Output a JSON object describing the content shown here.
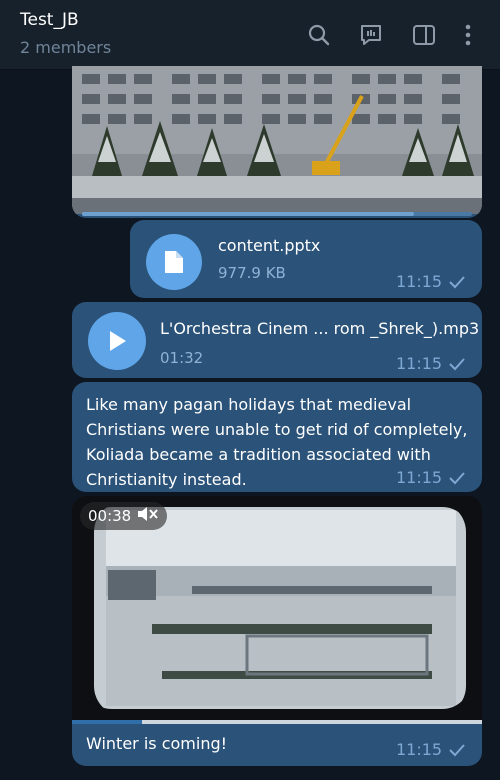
{
  "header": {
    "title": "Test_JB",
    "subtitle": "2 members",
    "icons": [
      "search-icon",
      "chat-bubble-icon",
      "sidebar-toggle-icon",
      "more-vertical-icon"
    ]
  },
  "messages": [
    {
      "type": "photo",
      "progress": 0.85
    },
    {
      "type": "file",
      "name": "content.pptx",
      "size": "977.9 KB",
      "time": "11:15",
      "icon": "file-icon"
    },
    {
      "type": "audio",
      "name": "L'Orchestra Cinem ... rom _Shrek_).mp3",
      "duration": "01:32",
      "time": "11:15",
      "icon": "play-icon"
    },
    {
      "type": "text",
      "text": "Like many pagan holidays that medieval Christians were unable to get rid of completely, Koliada became a tradition associated with Christianity instead.",
      "time": "11:15"
    },
    {
      "type": "video",
      "duration": "00:38",
      "muted": true,
      "progress": 0.17,
      "caption": "Winter is coming!",
      "time": "11:15"
    }
  ],
  "colors": {
    "background": "#0e1621",
    "header": "#17212b",
    "bubble": "#2b5278",
    "accent": "#5fa5e8",
    "meta_text": "#7da8d3"
  }
}
